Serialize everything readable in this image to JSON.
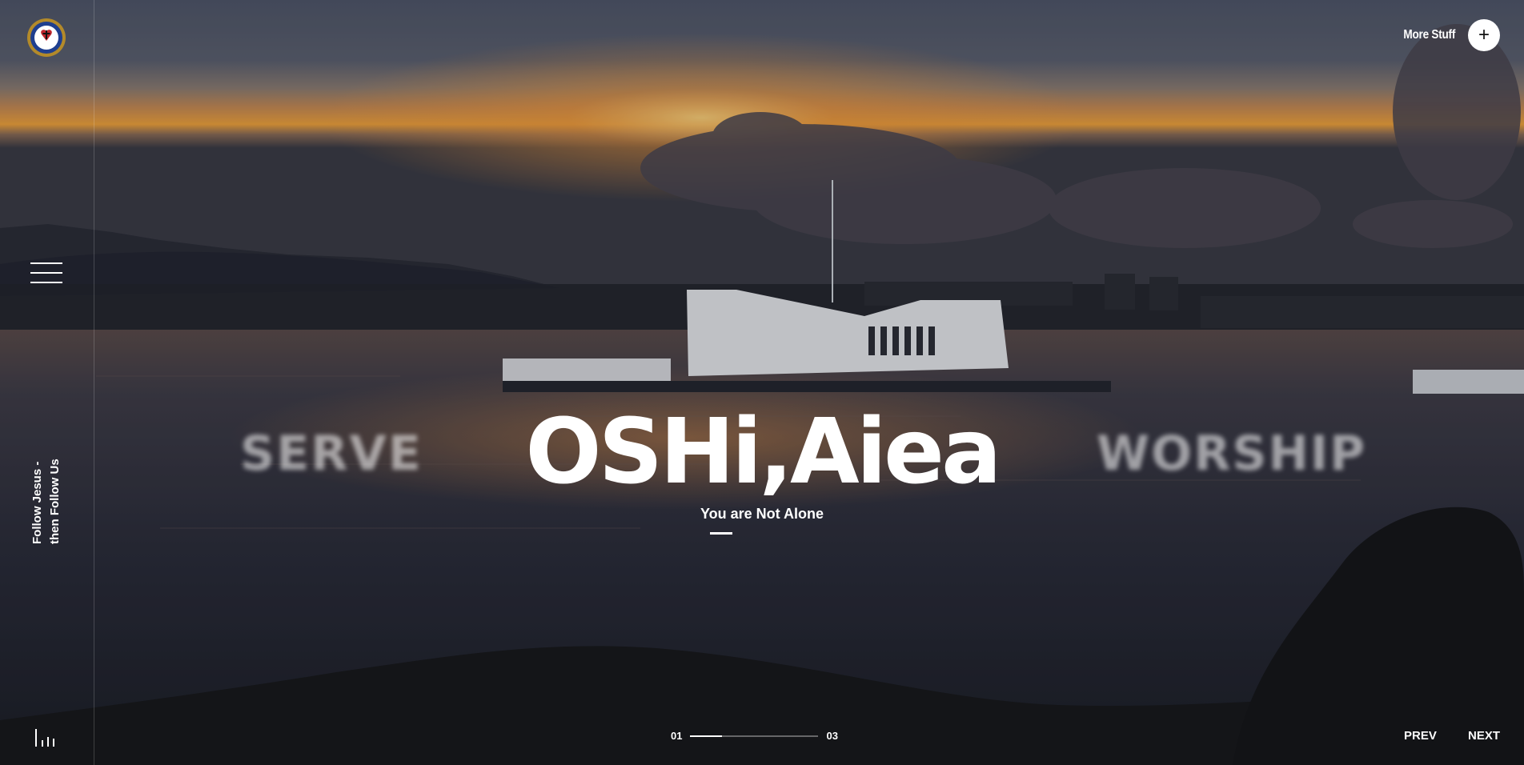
{
  "header": {
    "more_stuff_label": "More Stuff",
    "plus_glyph": "+"
  },
  "sidebar": {
    "vertical_text_line1": "Follow Jesus -",
    "vertical_text_line2": "then Follow Us"
  },
  "hero": {
    "title": "OSHi,Aiea",
    "subtitle": "You are Not Alone",
    "prev_slide_title": "SERVE",
    "next_slide_title": "WORSHIP"
  },
  "pager": {
    "current": "01",
    "total": "03",
    "progress": 0.25
  },
  "nav": {
    "prev_label": "PREV",
    "next_label": "NEXT"
  },
  "icons": {
    "logo": "luther-rose-logo-icon",
    "menu": "hamburger-menu-icon",
    "plus": "plus-icon",
    "sound": "sound-bars-icon"
  },
  "colors": {
    "sunset_orange": "#f0a43a",
    "sky_dark": "#4a5064",
    "water_dark": "#1f2230"
  }
}
